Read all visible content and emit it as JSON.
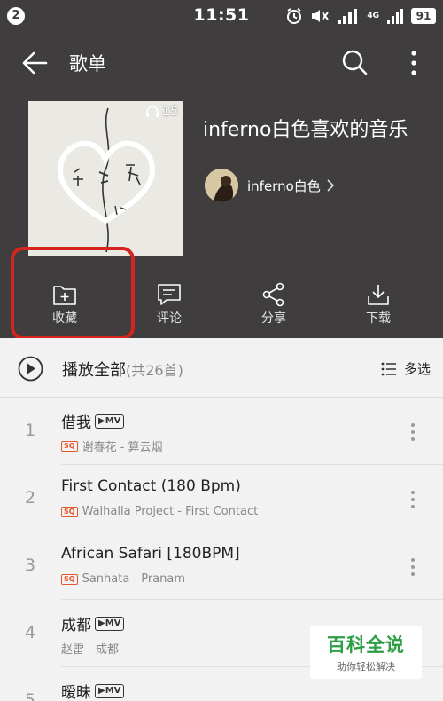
{
  "status_bar": {
    "notification_count": "2",
    "time": "11:51",
    "network": "4G",
    "battery": "91"
  },
  "header": {
    "title": "歌单",
    "play_count": "15",
    "playlist_name": "inferno白色喜欢的音乐",
    "creator_name": "inferno白色"
  },
  "actions": [
    {
      "label": "收藏",
      "icon": "folder-add-icon"
    },
    {
      "label": "评论",
      "icon": "comment-icon"
    },
    {
      "label": "分享",
      "icon": "share-icon"
    },
    {
      "label": "下载",
      "icon": "download-icon"
    }
  ],
  "play_all": {
    "label": "播放全部",
    "count": "(共26首)",
    "multi_select": "多选"
  },
  "tracks": [
    {
      "num": "1",
      "title": "借我",
      "mv": "▶MV",
      "quality": "SQ",
      "subtitle": "谢春花 - 算云烟"
    },
    {
      "num": "2",
      "title": "First Contact (180 Bpm)",
      "quality": "SQ",
      "subtitle": "Walhalla Project - First Contact"
    },
    {
      "num": "3",
      "title": "African Safari [180BPM]",
      "quality": "SQ",
      "subtitle": "Sanhata - Pranam"
    },
    {
      "num": "4",
      "title": "成都",
      "mv": "▶MV",
      "subtitle": "赵雷 - 成都"
    },
    {
      "num": "5",
      "title": "暧昧",
      "mv": "▶MV"
    }
  ],
  "watermark": {
    "title": "百科全说",
    "subtitle": "助你轻松解决"
  },
  "colors": {
    "header_bg": "#3f3d3e",
    "highlight": "#d6241e",
    "quality_badge": "#e4572e",
    "watermark_green": "#2c9f45"
  }
}
